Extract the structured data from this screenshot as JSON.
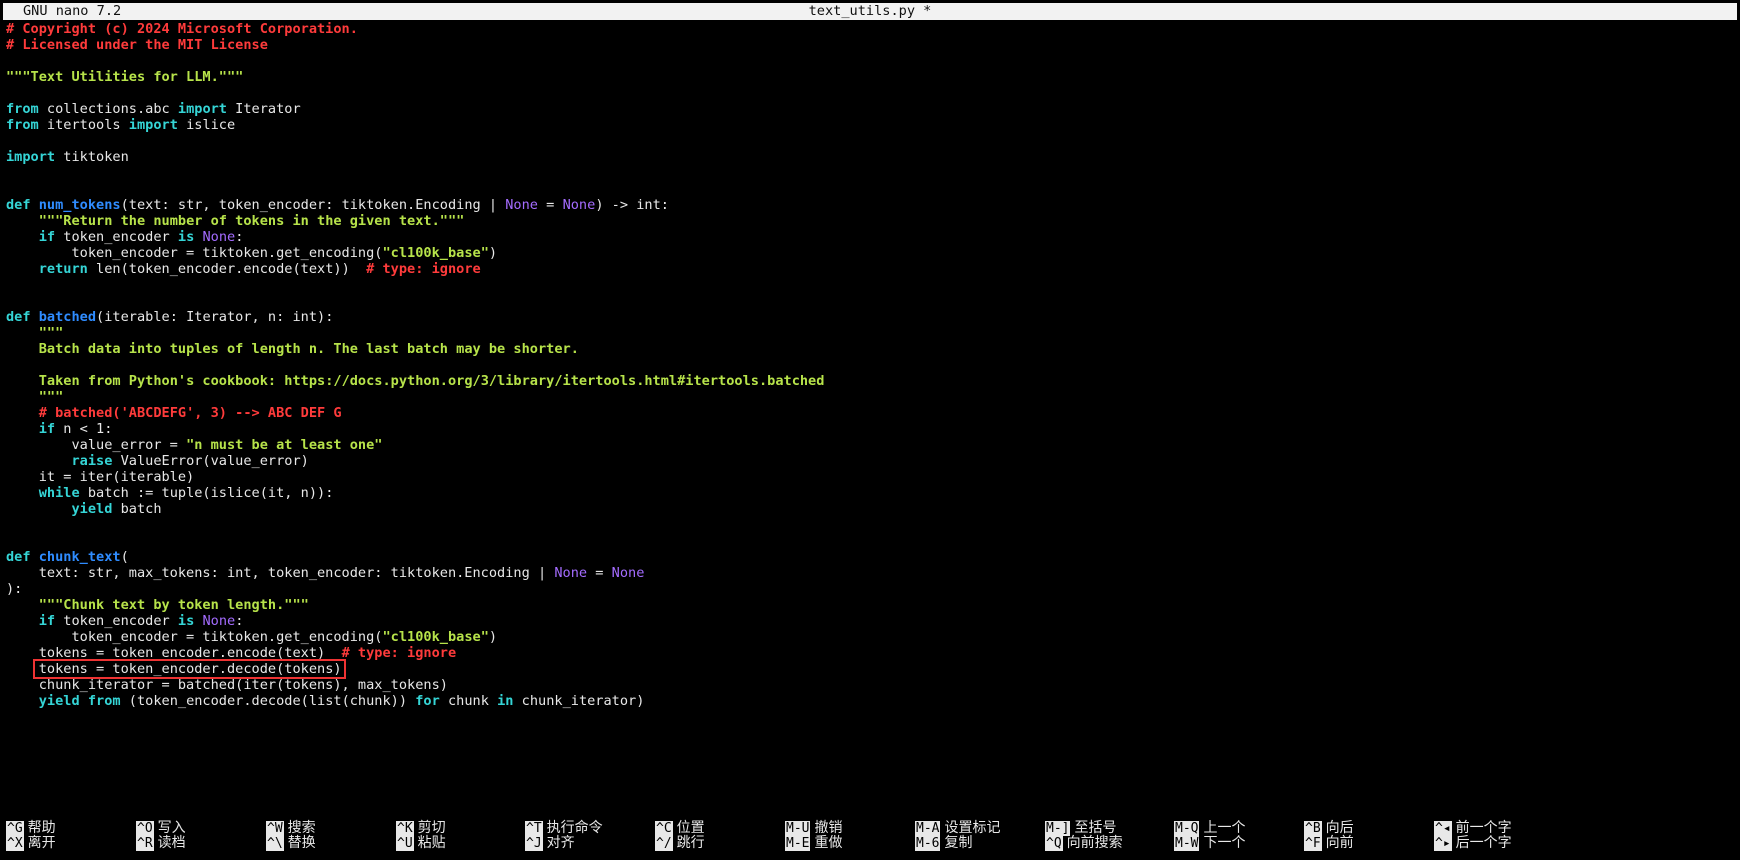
{
  "app": {
    "version": "GNU nano 7.2",
    "filename": "text_utils.py *"
  },
  "code": [
    [
      [
        "cmt",
        "# Copyright (c) 2024 Microsoft Corporation."
      ]
    ],
    [
      [
        "cmt",
        "# Licensed under the MIT License"
      ]
    ],
    [],
    [
      [
        "str",
        "\"\"\"Text Utilities for LLM.\"\"\""
      ]
    ],
    [],
    [
      [
        "kw",
        "from"
      ],
      [
        "plain",
        " collections.abc "
      ],
      [
        "kw",
        "import"
      ],
      [
        "plain",
        " Iterator"
      ]
    ],
    [
      [
        "kw",
        "from"
      ],
      [
        "plain",
        " itertools "
      ],
      [
        "kw",
        "import"
      ],
      [
        "plain",
        " islice"
      ]
    ],
    [],
    [
      [
        "kw",
        "import"
      ],
      [
        "plain",
        " tiktoken"
      ]
    ],
    [],
    [],
    [
      [
        "kw",
        "def"
      ],
      [
        "plain",
        " "
      ],
      [
        "fn",
        "num_tokens"
      ],
      [
        "plain",
        "(text: str, token_encoder: tiktoken.Encoding | "
      ],
      [
        "none",
        "None"
      ],
      [
        "plain",
        " = "
      ],
      [
        "none",
        "None"
      ],
      [
        "plain",
        ") -> int:"
      ]
    ],
    [
      [
        "plain",
        "    "
      ],
      [
        "str",
        "\"\"\"Return the number of tokens in the given text.\"\"\""
      ]
    ],
    [
      [
        "plain",
        "    "
      ],
      [
        "kw",
        "if"
      ],
      [
        "plain",
        " token_encoder "
      ],
      [
        "kw",
        "is"
      ],
      [
        "plain",
        " "
      ],
      [
        "none",
        "None"
      ],
      [
        "plain",
        ":"
      ]
    ],
    [
      [
        "plain",
        "        token_encoder = tiktoken.get_encoding("
      ],
      [
        "str",
        "\"cl100k_base\""
      ],
      [
        "plain",
        ")"
      ]
    ],
    [
      [
        "plain",
        "    "
      ],
      [
        "kw",
        "return"
      ],
      [
        "plain",
        " len(token_encoder.encode(text))  "
      ],
      [
        "cmt",
        "# type: ignore"
      ]
    ],
    [],
    [],
    [
      [
        "kw",
        "def"
      ],
      [
        "plain",
        " "
      ],
      [
        "fn",
        "batched"
      ],
      [
        "plain",
        "(iterable: Iterator, n: int):"
      ]
    ],
    [
      [
        "plain",
        "    "
      ],
      [
        "str",
        "\"\"\""
      ]
    ],
    [
      [
        "plain",
        "    "
      ],
      [
        "str",
        "Batch data into tuples of length n. The last batch may be shorter."
      ]
    ],
    [],
    [
      [
        "plain",
        "    "
      ],
      [
        "str",
        "Taken from Python's cookbook: https://docs.python.org/3/library/itertools.html#itertools.batched"
      ]
    ],
    [
      [
        "plain",
        "    "
      ],
      [
        "str",
        "\"\"\""
      ]
    ],
    [
      [
        "plain",
        "    "
      ],
      [
        "cmt",
        "# batched('ABCDEFG', 3) --> ABC DEF G"
      ]
    ],
    [
      [
        "plain",
        "    "
      ],
      [
        "kw",
        "if"
      ],
      [
        "plain",
        " n < 1:"
      ]
    ],
    [
      [
        "plain",
        "        value_error = "
      ],
      [
        "str",
        "\"n must be at least one\""
      ]
    ],
    [
      [
        "plain",
        "        "
      ],
      [
        "kw",
        "raise"
      ],
      [
        "plain",
        " ValueError(value_error)"
      ]
    ],
    [
      [
        "plain",
        "    it = iter(iterable)"
      ]
    ],
    [
      [
        "plain",
        "    "
      ],
      [
        "kw",
        "while"
      ],
      [
        "plain",
        " batch := tuple(islice(it, n)):"
      ]
    ],
    [
      [
        "plain",
        "        "
      ],
      [
        "kw",
        "yield"
      ],
      [
        "plain",
        " batch"
      ]
    ],
    [],
    [],
    [
      [
        "kw",
        "def"
      ],
      [
        "plain",
        " "
      ],
      [
        "fn",
        "chunk_text"
      ],
      [
        "plain",
        "("
      ]
    ],
    [
      [
        "plain",
        "    text: str, max_tokens: int, token_encoder: tiktoken.Encoding | "
      ],
      [
        "none",
        "None"
      ],
      [
        "plain",
        " = "
      ],
      [
        "none",
        "None"
      ]
    ],
    [
      [
        "plain",
        "):"
      ]
    ],
    [
      [
        "plain",
        "    "
      ],
      [
        "str",
        "\"\"\"Chunk text by token length.\"\"\""
      ]
    ],
    [
      [
        "plain",
        "    "
      ],
      [
        "kw",
        "if"
      ],
      [
        "plain",
        " token_encoder "
      ],
      [
        "kw",
        "is"
      ],
      [
        "plain",
        " "
      ],
      [
        "none",
        "None"
      ],
      [
        "plain",
        ":"
      ]
    ],
    [
      [
        "plain",
        "        token_encoder = tiktoken.get_encoding("
      ],
      [
        "str",
        "\"cl100k_base\""
      ],
      [
        "plain",
        ")"
      ]
    ],
    [
      [
        "plain",
        "    tokens = token_encoder.encode(text)  "
      ],
      [
        "cmt",
        "# type: ignore"
      ]
    ],
    [
      [
        "plain",
        "    "
      ],
      [
        "hl",
        "tokens = token_encoder.decode(tokens)"
      ]
    ],
    [
      [
        "plain",
        "    chunk_iterator = batched(iter(tokens), max_tokens)"
      ]
    ],
    [
      [
        "plain",
        "    "
      ],
      [
        "kw",
        "yield from"
      ],
      [
        "plain",
        " (token_encoder.decode(list(chunk)) "
      ],
      [
        "kw",
        "for"
      ],
      [
        "plain",
        " chunk "
      ],
      [
        "kw",
        "in"
      ],
      [
        "plain",
        " chunk_iterator)"
      ]
    ]
  ],
  "shortcuts": [
    [
      {
        "key": "^G",
        "label": "帮助"
      },
      {
        "key": "^O",
        "label": "写入"
      },
      {
        "key": "^W",
        "label": "搜索"
      },
      {
        "key": "^K",
        "label": "剪切"
      },
      {
        "key": "^T",
        "label": "执行命令"
      },
      {
        "key": "^C",
        "label": "位置"
      },
      {
        "key": "M-U",
        "label": "撤销"
      },
      {
        "key": "M-A",
        "label": "设置标记"
      },
      {
        "key": "M-]",
        "label": "至括号"
      },
      {
        "key": "M-Q",
        "label": "上一个"
      },
      {
        "key": "^B",
        "label": "向后"
      },
      {
        "key": "^◂",
        "label": "前一个字"
      }
    ],
    [
      {
        "key": "^X",
        "label": "离开"
      },
      {
        "key": "^R",
        "label": "读档"
      },
      {
        "key": "^\\",
        "label": "替换"
      },
      {
        "key": "^U",
        "label": "粘贴"
      },
      {
        "key": "^J",
        "label": "对齐"
      },
      {
        "key": "^/",
        "label": "跳行"
      },
      {
        "key": "M-E",
        "label": "重做"
      },
      {
        "key": "M-6",
        "label": "复制"
      },
      {
        "key": "^Q",
        "label": "向前搜索"
      },
      {
        "key": "M-W",
        "label": "下一个"
      },
      {
        "key": "^F",
        "label": "向前"
      },
      {
        "key": "^▸",
        "label": "后一个字"
      }
    ]
  ]
}
